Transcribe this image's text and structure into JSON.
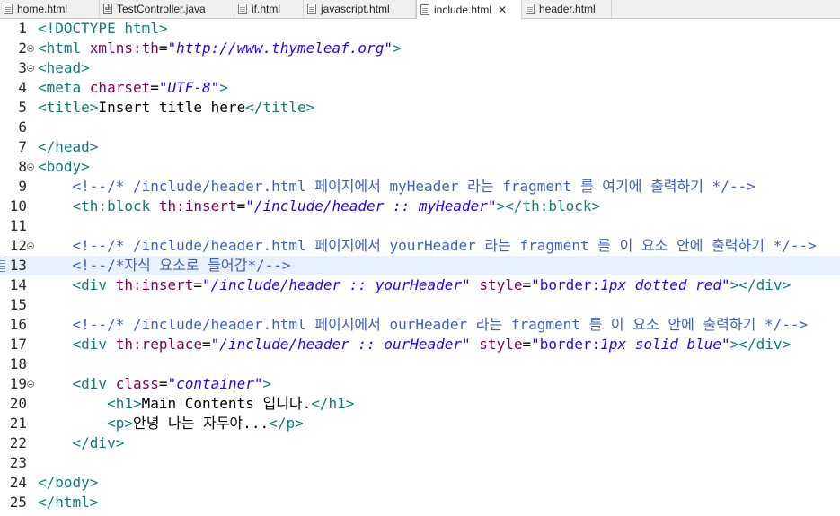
{
  "tabs": [
    {
      "label": "home.html",
      "icon": "html-file-icon",
      "active": false
    },
    {
      "label": "TestController.java",
      "icon": "java-file-icon",
      "active": false
    },
    {
      "label": "if.html",
      "icon": "html-file-icon",
      "active": false
    },
    {
      "label": "javascript.html",
      "icon": "html-file-icon",
      "active": false
    },
    {
      "label": "include.html",
      "icon": "html-file-icon",
      "active": true,
      "close": "✕"
    },
    {
      "label": "header.html",
      "icon": "html-file-icon",
      "active": false
    }
  ],
  "editor": {
    "highlighted_line": 13,
    "lines": [
      {
        "n": "1",
        "seg": [
          [
            "tg",
            "<!DOCTYPE html>"
          ]
        ]
      },
      {
        "n": "2",
        "fold": true,
        "seg": [
          [
            "tg",
            "<html "
          ],
          [
            "an",
            "xmlns:th"
          ],
          [
            "tx",
            "="
          ],
          [
            "av",
            "\"http://www.thymeleaf.org\""
          ],
          [
            "tg",
            ">"
          ]
        ]
      },
      {
        "n": "3",
        "fold": true,
        "seg": [
          [
            "tg",
            "<head>"
          ]
        ]
      },
      {
        "n": "4",
        "seg": [
          [
            "tg",
            "<meta "
          ],
          [
            "an",
            "charset"
          ],
          [
            "tx",
            "="
          ],
          [
            "av",
            "\"UTF-8\""
          ],
          [
            "tg",
            ">"
          ]
        ]
      },
      {
        "n": "5",
        "seg": [
          [
            "tg",
            "<title>"
          ],
          [
            "tx",
            "Insert title here"
          ],
          [
            "tg",
            "</title>"
          ]
        ]
      },
      {
        "n": "6",
        "seg": []
      },
      {
        "n": "7",
        "seg": [
          [
            "tg",
            "</head>"
          ]
        ]
      },
      {
        "n": "8",
        "fold": true,
        "seg": [
          [
            "tg",
            "<body>"
          ]
        ]
      },
      {
        "n": "9",
        "seg": [
          [
            "tx",
            "    "
          ],
          [
            "cm",
            "<!--/* /include/header.html 페이지에서 myHeader 라는 fragment 를 여기에 출력하기 */-->"
          ]
        ]
      },
      {
        "n": "10",
        "seg": [
          [
            "tx",
            "    "
          ],
          [
            "tg",
            "<th:block "
          ],
          [
            "an",
            "th:insert"
          ],
          [
            "tx",
            "="
          ],
          [
            "av",
            "\"/include/header :: myHeader\""
          ],
          [
            "tg",
            "></th:block>"
          ]
        ]
      },
      {
        "n": "11",
        "seg": []
      },
      {
        "n": "12",
        "fold": true,
        "seg": [
          [
            "tx",
            "    "
          ],
          [
            "cm",
            "<!--/* /include/header.html 페이지에서 yourHeader 라는 fragment 를 이 요소 안에 출력하기 */-->"
          ]
        ]
      },
      {
        "n": "13",
        "mark": true,
        "seg": [
          [
            "tx",
            "    "
          ],
          [
            "cm",
            "<!--/*자식 요소로 들어감*/-->"
          ]
        ]
      },
      {
        "n": "14",
        "seg": [
          [
            "tx",
            "    "
          ],
          [
            "tg",
            "<div "
          ],
          [
            "an",
            "th:insert"
          ],
          [
            "tx",
            "="
          ],
          [
            "av",
            "\"/include/header :: yourHeader\""
          ],
          [
            "tx",
            " "
          ],
          [
            "an",
            "style"
          ],
          [
            "tx",
            "="
          ],
          [
            "st",
            "\"border:"
          ],
          [
            "av",
            "1px dotted red"
          ],
          [
            "st",
            "\""
          ],
          [
            "tg",
            "></div>"
          ]
        ]
      },
      {
        "n": "15",
        "seg": []
      },
      {
        "n": "16",
        "seg": [
          [
            "tx",
            "    "
          ],
          [
            "cm",
            "<!--/* /include/header.html 페이지에서 ourHeader 라는 fragment 를 이 요소 안에 출력하기 */-->"
          ]
        ]
      },
      {
        "n": "17",
        "seg": [
          [
            "tx",
            "    "
          ],
          [
            "tg",
            "<div "
          ],
          [
            "an",
            "th:replace"
          ],
          [
            "tx",
            "="
          ],
          [
            "av",
            "\"/include/header :: ourHeader\""
          ],
          [
            "tx",
            " "
          ],
          [
            "an",
            "style"
          ],
          [
            "tx",
            "="
          ],
          [
            "st",
            "\"border:"
          ],
          [
            "av",
            "1px solid blue"
          ],
          [
            "st",
            "\""
          ],
          [
            "tg",
            "></div>"
          ]
        ]
      },
      {
        "n": "18",
        "seg": []
      },
      {
        "n": "19",
        "fold": true,
        "seg": [
          [
            "tx",
            "    "
          ],
          [
            "tg",
            "<div "
          ],
          [
            "an",
            "class"
          ],
          [
            "tx",
            "="
          ],
          [
            "av",
            "\"container\""
          ],
          [
            "tg",
            ">"
          ]
        ]
      },
      {
        "n": "20",
        "seg": [
          [
            "tx",
            "        "
          ],
          [
            "tg",
            "<h1>"
          ],
          [
            "tx",
            "Main Contents 입니다."
          ],
          [
            "tg",
            "</h1>"
          ]
        ]
      },
      {
        "n": "21",
        "seg": [
          [
            "tx",
            "        "
          ],
          [
            "tg",
            "<p>"
          ],
          [
            "tx",
            "안녕 나는 자두야..."
          ],
          [
            "tg",
            "</p>"
          ]
        ]
      },
      {
        "n": "22",
        "seg": [
          [
            "tx",
            "    "
          ],
          [
            "tg",
            "</div>"
          ]
        ]
      },
      {
        "n": "23",
        "seg": []
      },
      {
        "n": "24",
        "seg": [
          [
            "tg",
            "</body>"
          ]
        ]
      },
      {
        "n": "25",
        "seg": [
          [
            "tg",
            "</html>"
          ]
        ]
      }
    ]
  }
}
